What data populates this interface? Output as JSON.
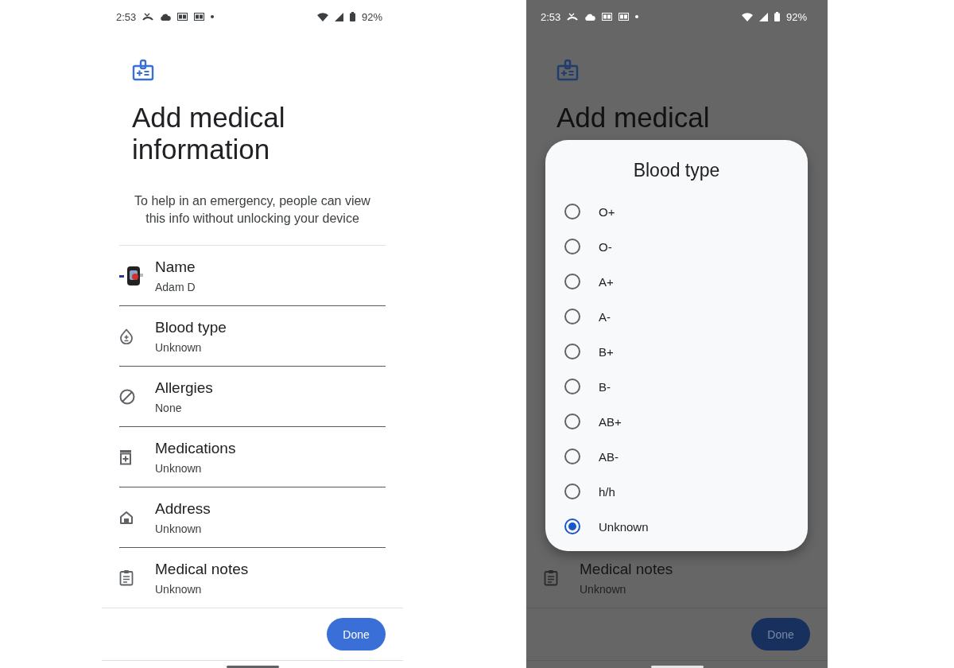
{
  "screens": [
    {
      "dimmed": false,
      "status_bar": {
        "time": "2:53",
        "battery": "92%"
      },
      "title": "Add medical information",
      "description": "To help in an emergency, people can view this info without unlocking your device",
      "items": [
        {
          "kind": "avatar",
          "label": "Name",
          "value": "Adam D"
        },
        {
          "kind": "blood",
          "label": "Blood type",
          "value": "Unknown"
        },
        {
          "kind": "allergy",
          "label": "Allergies",
          "value": "None"
        },
        {
          "kind": "medication",
          "label": "Medications",
          "value": "Unknown"
        },
        {
          "kind": "address",
          "label": "Address",
          "value": "Unknown"
        },
        {
          "kind": "notes",
          "label": "Medical notes",
          "value": "Unknown"
        }
      ],
      "done_button": "Done"
    },
    {
      "dimmed": true,
      "status_bar": {
        "time": "2:53",
        "battery": "92%"
      },
      "title": "Add medical",
      "items": [
        {
          "kind": "notes",
          "label": "Medical notes",
          "value": "Unknown"
        }
      ],
      "done_button": "Done",
      "dialog": {
        "title": "Blood type",
        "options": [
          {
            "label": "O+",
            "selected": false
          },
          {
            "label": "O-",
            "selected": false
          },
          {
            "label": "A+",
            "selected": false
          },
          {
            "label": "A-",
            "selected": false
          },
          {
            "label": "B+",
            "selected": false
          },
          {
            "label": "B-",
            "selected": false
          },
          {
            "label": "AB+",
            "selected": false
          },
          {
            "label": "AB-",
            "selected": false
          },
          {
            "label": "h/h",
            "selected": false
          },
          {
            "label": "Unknown",
            "selected": true
          }
        ]
      }
    }
  ]
}
